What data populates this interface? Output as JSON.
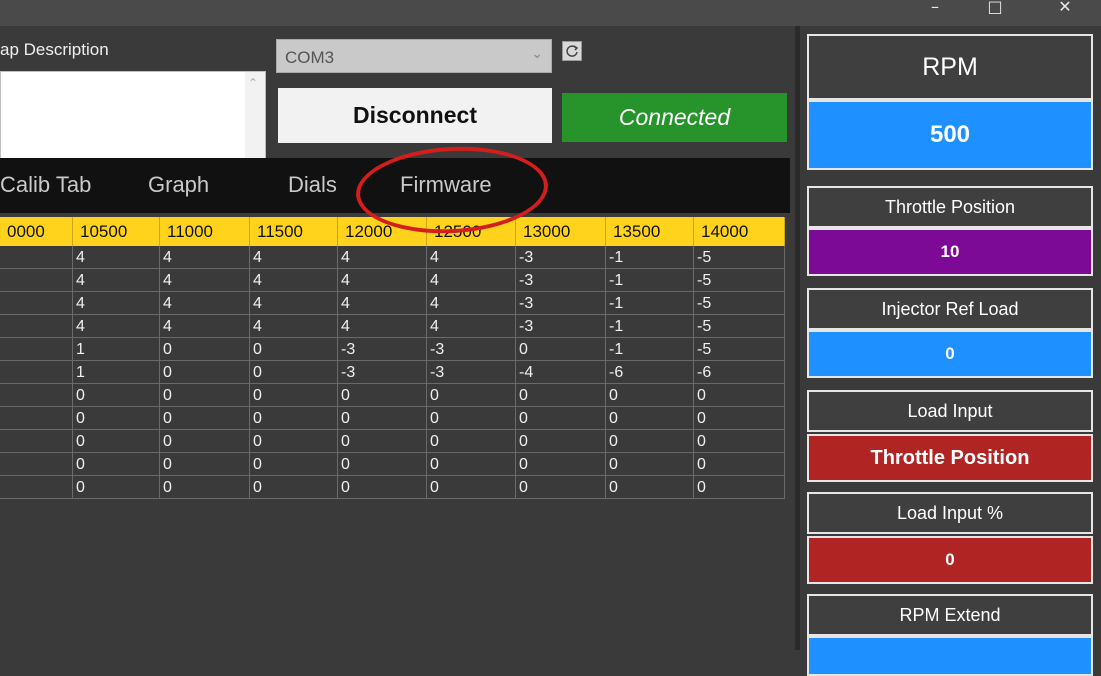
{
  "window": {
    "minimize_glyph": "–",
    "maximize_glyph": "□",
    "close_glyph": "✕"
  },
  "map_description": {
    "label": "ap Description",
    "scroll_up": "⌃",
    "scroll_down": "⌄"
  },
  "connection": {
    "port": "COM3",
    "port_chevron": "⌄",
    "disconnect_label": "Disconnect",
    "status": "Connected",
    "status_color": "#27942b"
  },
  "tabs": [
    "Calib Tab",
    "Graph",
    "Dials",
    "Firmware"
  ],
  "annotation": {
    "highlight_color": "#d41e1e",
    "highlighted_tab": "Firmware"
  },
  "table": {
    "header_color": "#ffd31c",
    "columns": [
      "0000",
      "10500",
      "11000",
      "11500",
      "12000",
      "12500",
      "13000",
      "13500",
      "14000"
    ],
    "rows": [
      [
        "",
        "4",
        "4",
        "4",
        "4",
        "4",
        "-3",
        "-1",
        "-5"
      ],
      [
        "",
        "4",
        "4",
        "4",
        "4",
        "4",
        "-3",
        "-1",
        "-5"
      ],
      [
        "",
        "4",
        "4",
        "4",
        "4",
        "4",
        "-3",
        "-1",
        "-5"
      ],
      [
        "",
        "4",
        "4",
        "4",
        "4",
        "4",
        "-3",
        "-1",
        "-5"
      ],
      [
        "",
        "1",
        "0",
        "0",
        "-3",
        "-3",
        "0",
        "-1",
        "-5"
      ],
      [
        "",
        "1",
        "0",
        "0",
        "-3",
        "-3",
        "-4",
        "-6",
        "-6"
      ],
      [
        "",
        "0",
        "0",
        "0",
        "0",
        "0",
        "0",
        "0",
        "0"
      ],
      [
        "",
        "0",
        "0",
        "0",
        "0",
        "0",
        "0",
        "0",
        "0"
      ],
      [
        "",
        "0",
        "0",
        "0",
        "0",
        "0",
        "0",
        "0",
        "0"
      ],
      [
        "",
        "0",
        "0",
        "0",
        "0",
        "0",
        "0",
        "0",
        "0"
      ],
      [
        "",
        "0",
        "0",
        "0",
        "0",
        "0",
        "0",
        "0",
        "0"
      ]
    ]
  },
  "gauges": [
    {
      "label": "RPM",
      "value": "500",
      "color": "#1e90ff"
    },
    {
      "label": "Throttle Position",
      "value": "10",
      "color": "#7d0a96"
    },
    {
      "label": "Injector Ref Load",
      "value": "0",
      "color": "#1e90ff"
    },
    {
      "label": "Load Input",
      "value": "Throttle Position",
      "color": "#b02424"
    },
    {
      "label": "Load Input %",
      "value": "0",
      "color": "#b02424"
    },
    {
      "label": "RPM Extend",
      "value": "",
      "color": "#1e90ff"
    }
  ]
}
